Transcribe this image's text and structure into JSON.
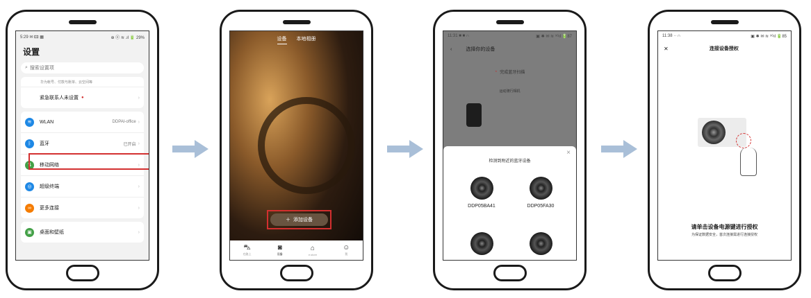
{
  "screen1": {
    "status_left": "5:29 ✉ 🖾 ▦",
    "status_right": "⊕ ⓝ ≋ .ıl 🔋 29%",
    "title": "设置",
    "search_placeholder": "搜索设置项",
    "account_subtitle": "华为帐号、付款与账单、云空间等",
    "emergency_label": "紧急联系人未设置",
    "rows": [
      {
        "label": "WLAN",
        "value": "DDPAI-office",
        "color": "#1e88e5"
      },
      {
        "label": "蓝牙",
        "value": "已开启",
        "color": "#1e88e5"
      },
      {
        "label": "移动网络",
        "value": "",
        "color": "#43a047"
      },
      {
        "label": "超级终端",
        "value": "",
        "color": "#1e88e5"
      },
      {
        "label": "更多连接",
        "value": "",
        "color": "#f57c00"
      }
    ],
    "wallpaper_label": "桌面和壁纸"
  },
  "screen2": {
    "tabs": [
      "设备",
      "本地相册"
    ],
    "add_button": "添加设备",
    "tabbar": [
      {
        "icon": "car",
        "label": "在路上"
      },
      {
        "icon": "camera",
        "label": "设备"
      },
      {
        "icon": "store",
        "label": "e.store"
      },
      {
        "icon": "smile",
        "label": "我"
      }
    ]
  },
  "screen3": {
    "status_left": "11:31 ■ ■ ∩",
    "status_right": "▣ ✱ ✉ ≋ ⁵ᴳıl 🔋87",
    "title": "选择你的设备",
    "scan_label": "完成蓝牙扫描",
    "section_label": "运动骑行相机",
    "sheet_title": "检测到附近的蓝牙设备",
    "devices": [
      "DDP05BA41",
      "DDP05FA30",
      "",
      ""
    ]
  },
  "screen4": {
    "status_left": "11:38 ·· ∩",
    "status_right": "▣ ✱ ✉ ≋ ⁵ᴳıl 🔋85",
    "title": "连接设备授权",
    "instruction": "请单击设备电源键进行授权",
    "sub_instruction": "为保证数据安全，首次连接需进行连接授权"
  },
  "colors": {
    "highlight": "#d32f2f",
    "arrow": "#a9bfd8"
  }
}
